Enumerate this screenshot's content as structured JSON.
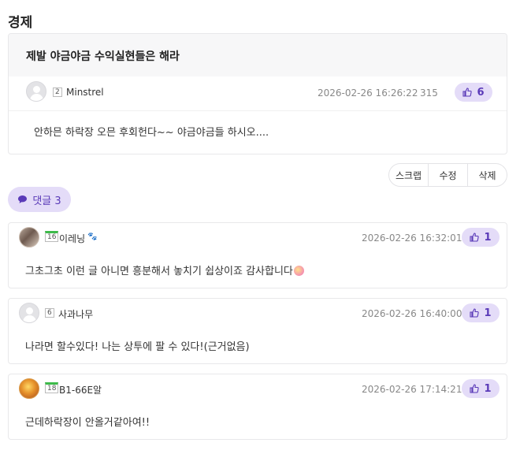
{
  "board": {
    "title": "경제"
  },
  "post": {
    "title": "제발 야금야금 수익실현들은 해라",
    "author": {
      "level": "2",
      "nickname": "Minstrel"
    },
    "date": "2026-02-26 16:26:22",
    "views": "315",
    "likes": "6",
    "body": "안하믄 하락장 오믄 후회헌다~~ 야금야금들 하시오...."
  },
  "actions": {
    "scrap": "스크랩",
    "edit": "수정",
    "delete": "삭제"
  },
  "comments_header": {
    "label": "댓글 3"
  },
  "comments": [
    {
      "level": "16",
      "nickname": "이레닝",
      "date": "2026-02-26 16:32:01",
      "likes": "1",
      "text": "그초그초 이런 글 아니면 흥분해서 놓치기 쉽상이죠 감사합니다"
    },
    {
      "level": "6",
      "nickname": "사과나무",
      "date": "2026-02-26 16:40:00",
      "likes": "1",
      "text": "나라면 할수있다! 나는 상투에 팔 수 있다!(근거없음)"
    },
    {
      "level": "18",
      "nickname": "B1-66E알",
      "date": "2026-02-26 17:14:21",
      "likes": "1",
      "text": "근데하락장이 안올거같아여!!"
    }
  ],
  "colors": {
    "accent": "#5a3ab8",
    "accent_bg": "#e4dcf8",
    "level_badge_green": "#3dbb4a"
  }
}
